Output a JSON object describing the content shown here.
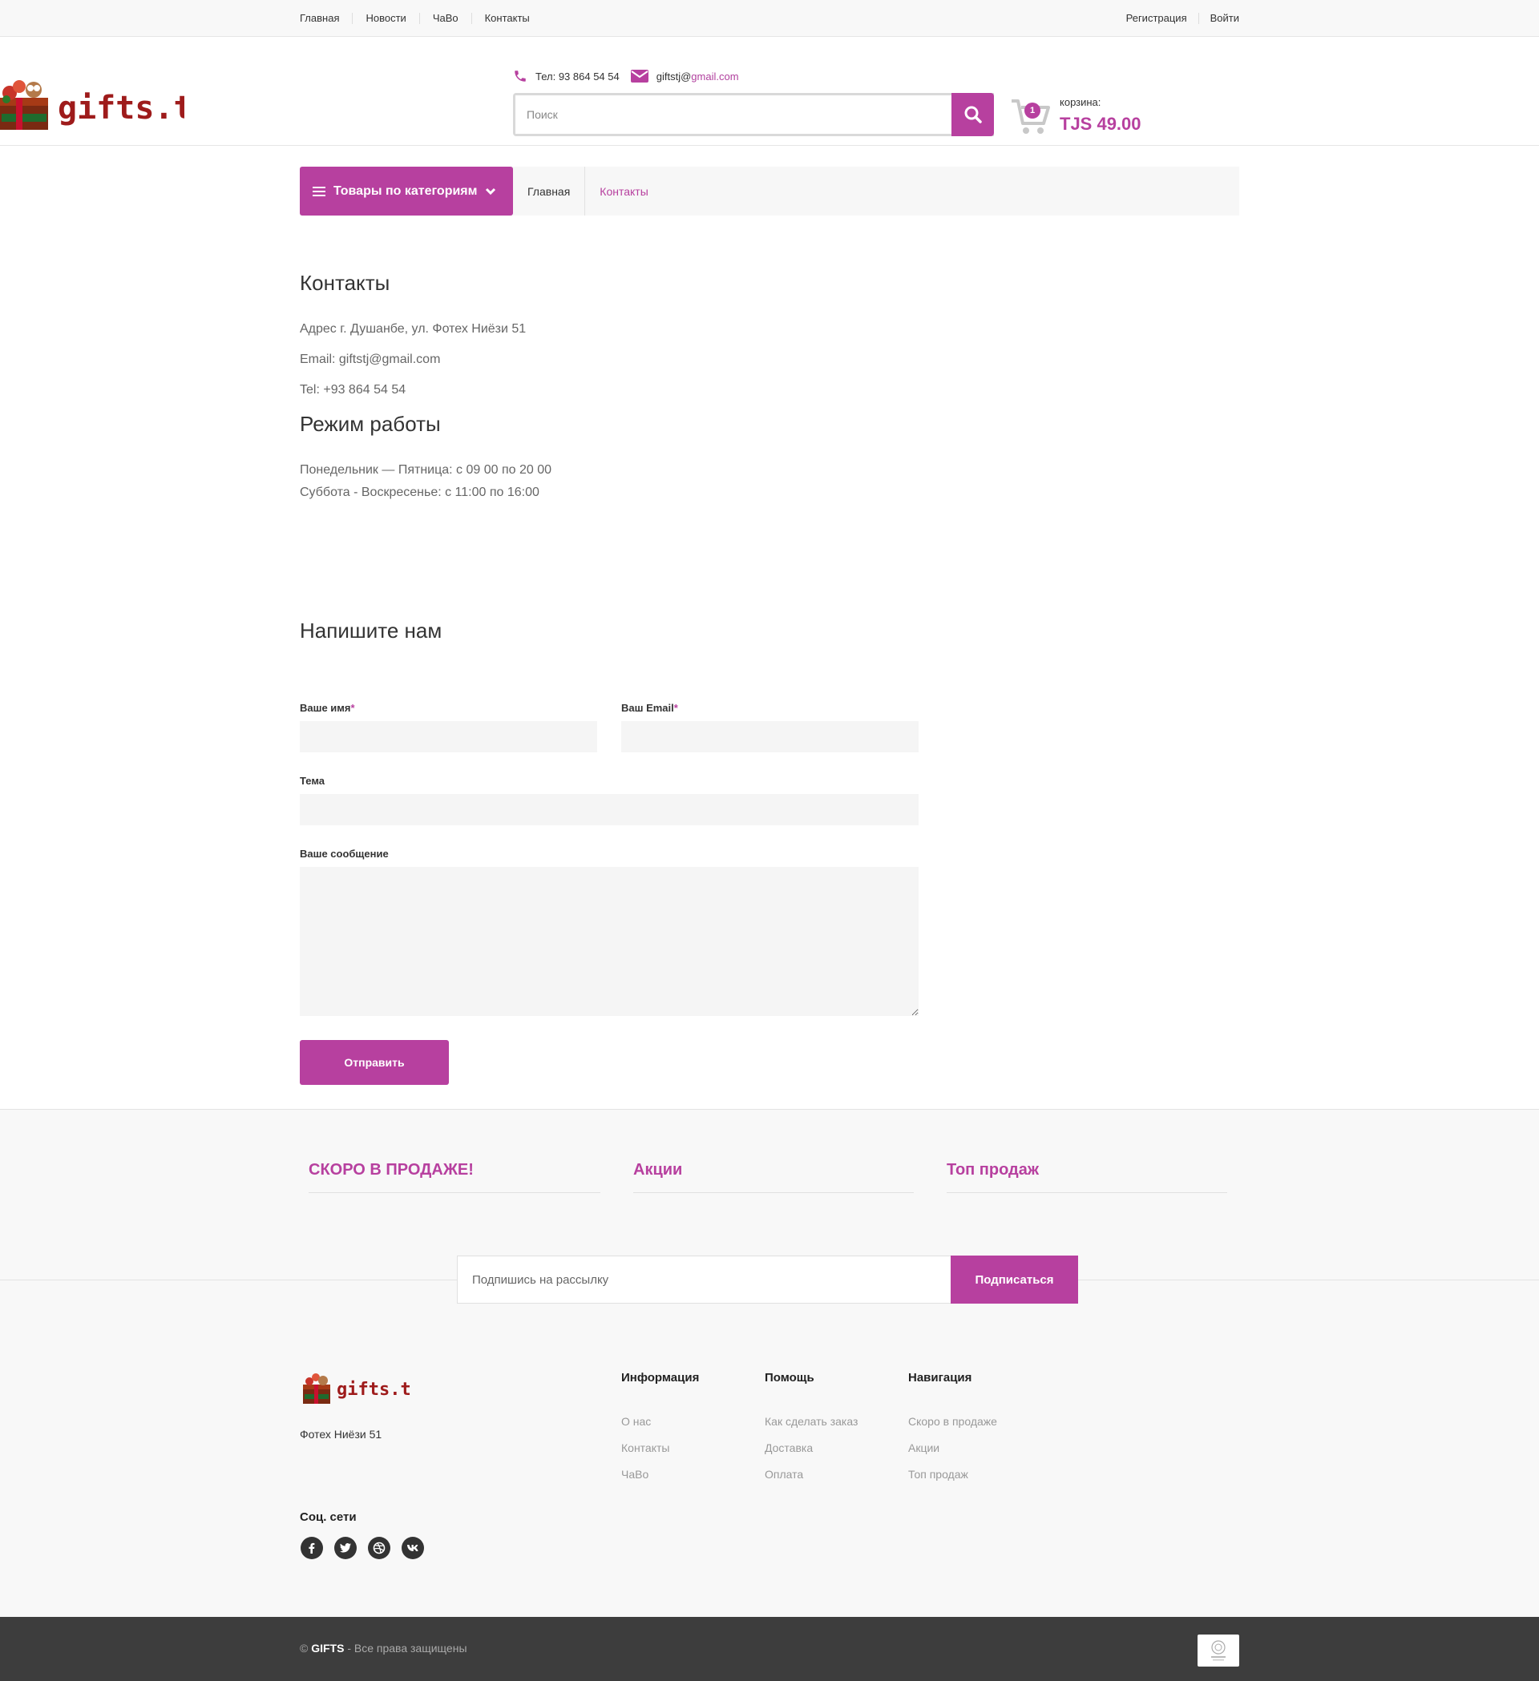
{
  "topnav": {
    "left": [
      "Главная",
      "Новости",
      "ЧаВо",
      "Контакты"
    ],
    "right": [
      "Регистрация",
      "Войти"
    ]
  },
  "header": {
    "logo_text": "gifts.tj",
    "phone": "Тел: 93 864 54 54",
    "email_user": "giftstj@",
    "email_domain": "gmail.com",
    "search_placeholder": "Поиск",
    "cart_count": "1",
    "cart_label": "корзина:",
    "cart_total": "TJS 49.00"
  },
  "catbar": {
    "button_label": "Товары по категориям",
    "breadcrumb": [
      "Главная",
      "Контакты"
    ]
  },
  "contacts": {
    "title": "Контакты",
    "address": "Адрес г. Душанбе, ул. Фотех Ниёзи 51",
    "email": "Email: giftstj@gmail.com",
    "tel": "Tel: +93 864 54 54",
    "hours_title": "Режим работы",
    "hours": [
      "Понедельник — Пятница: с 09 00 по 20 00",
      "Суббота - Воскресенье: с 11:00 по 16:00"
    ]
  },
  "form": {
    "title": "Напишите нам",
    "name_label": "Ваше имя",
    "email_label": "Ваш Email",
    "required_mark": "*",
    "subject_label": "Тема",
    "message_label": "Ваше сообщение",
    "submit_label": "Отправить"
  },
  "promo": {
    "titles": [
      "СКОРО В ПРОДАЖЕ!",
      "Акции",
      "Топ продаж"
    ]
  },
  "newsletter": {
    "placeholder": "Подпишись на рассылку",
    "button": "Подписаться"
  },
  "footer": {
    "logo_text": "gifts.tj",
    "address": "Фотех Ниёзи 51",
    "columns": [
      {
        "title": "Информация",
        "links": [
          "О нас",
          "Контакты",
          "ЧаВо"
        ]
      },
      {
        "title": "Помощь",
        "links": [
          "Как сделать заказ",
          "Доставка",
          "Оплата"
        ]
      },
      {
        "title": "Навигация",
        "links": [
          "Скоро в продаже",
          "Акции",
          "Топ продаж"
        ]
      }
    ],
    "social_title": "Соц. сети",
    "social": [
      "facebook-icon",
      "twitter-icon",
      "dribbble-icon",
      "vk-icon"
    ],
    "copyright_symbol": "©",
    "copyright_brand": "GIFTS",
    "copyright_rest": " - Все права защищены"
  },
  "colors": {
    "accent": "#b7409f",
    "logo_red": "#9e1b1b",
    "footer_dark": "#3d3d3d"
  }
}
